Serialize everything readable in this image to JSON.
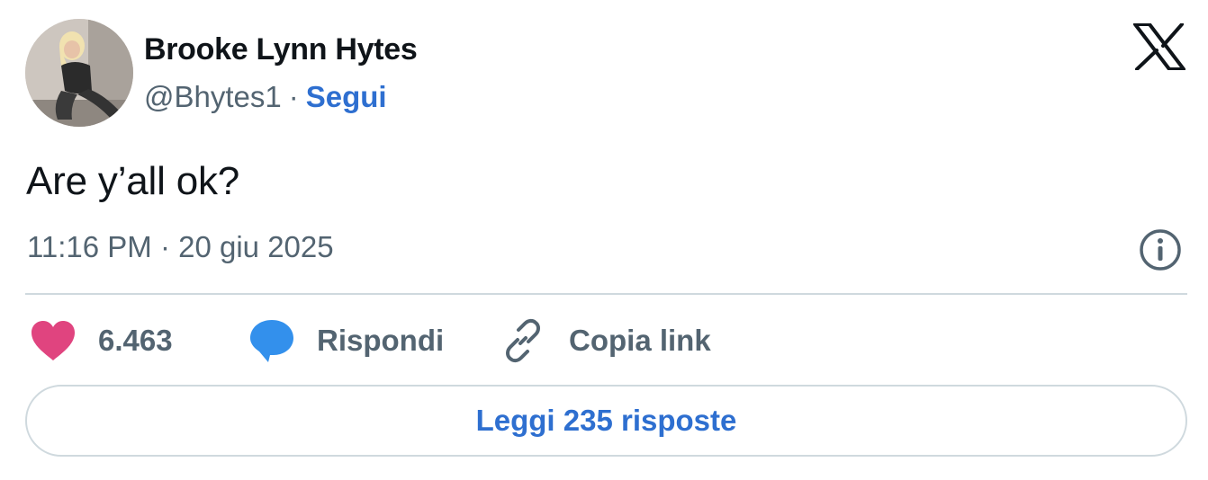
{
  "author": {
    "display_name": "Brooke Lynn Hytes",
    "handle": "@Bhytes1",
    "separator": "·",
    "follow_label": "Segui"
  },
  "tweet": {
    "text": "Are y’all ok?",
    "timestamp": "11:16 PM · 20 giu 2025"
  },
  "actions": {
    "likes_count": "6.463",
    "reply_label": "Rispondi",
    "copy_link_label": "Copia link"
  },
  "read_replies_label": "Leggi 235 risposte",
  "icons": {
    "logo": "x-logo-icon",
    "info": "info-icon",
    "like": "heart-icon",
    "reply": "speech-bubble-icon",
    "copy": "link-icon"
  },
  "colors": {
    "heart": "#e0447f",
    "reply": "#3390ec",
    "link_blue": "#2e6fd0",
    "muted": "#536471",
    "border": "#cfd9de"
  }
}
